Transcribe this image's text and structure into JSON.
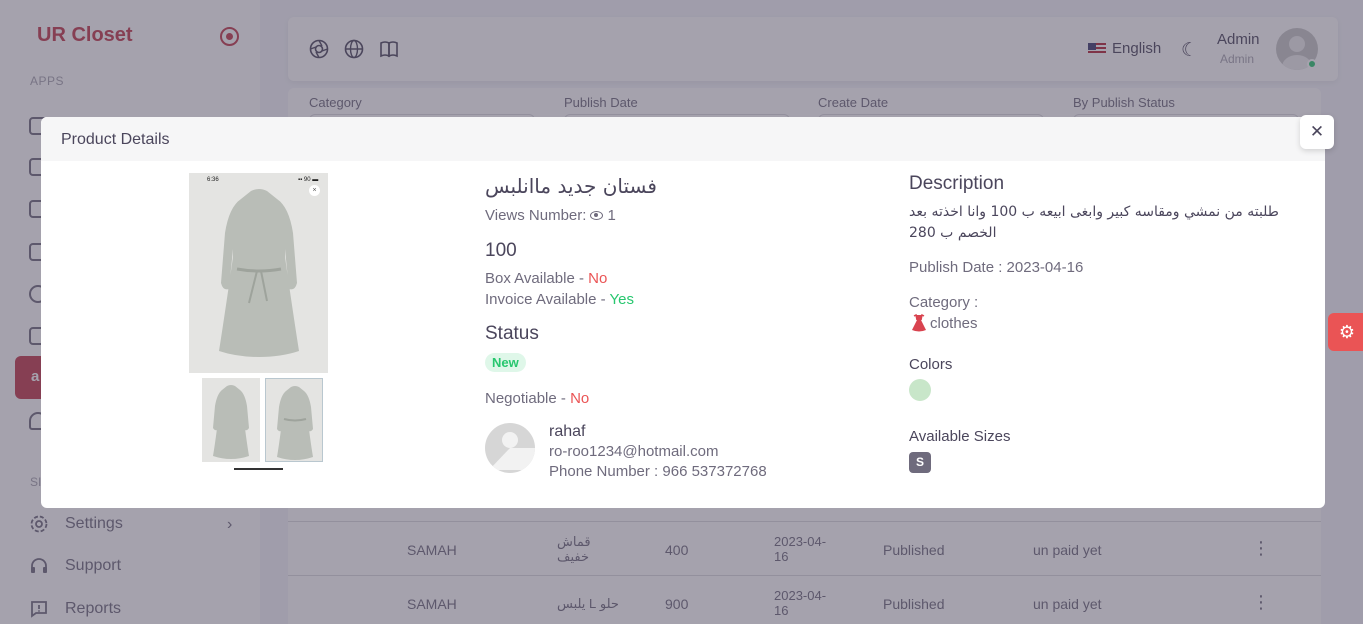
{
  "app": {
    "logo": "UR Closet"
  },
  "sidebar": {
    "apps_label": "APPS",
    "section_label": "SI",
    "active_letter": "a",
    "items": [
      {
        "label": "Settings",
        "icon": "gear-icon"
      },
      {
        "label": "Support",
        "icon": "headset-icon"
      },
      {
        "label": "Reports",
        "icon": "report-icon"
      }
    ]
  },
  "navbar": {
    "language": "English",
    "user_name": "Admin",
    "user_role": "Admin"
  },
  "filters": {
    "labels": [
      "Category",
      "Publish Date",
      "Create Date",
      "By Publish Status"
    ]
  },
  "table": {
    "rows": [
      {
        "seller": "SAMAH",
        "product": "قماش خفيف",
        "price": "400",
        "date": "2023-04-16",
        "status": "Published",
        "payment": "un paid yet"
      },
      {
        "seller": "SAMAH",
        "product": "حلو L يلبس",
        "price": "900",
        "date": "2023-04-16",
        "status": "Published",
        "payment": "un paid yet"
      }
    ]
  },
  "modal": {
    "title": "Product Details",
    "close_glyph": "✕",
    "image": {
      "time": "6:36",
      "status_bar": "▪▪ 90 ▬",
      "close_glyph": "×"
    },
    "product": {
      "title": "فستان جديد ماانلبس",
      "views_label": "Views Number:",
      "views": "1",
      "price": "100",
      "box_label": "Box Available - ",
      "box_value": "No",
      "invoice_label": "Invoice Available - ",
      "invoice_value": "Yes",
      "status_heading": "Status",
      "status_badge": "New",
      "negotiable_label": "Negotiable - ",
      "negotiable_value": "No"
    },
    "seller": {
      "name": "rahaf",
      "email": "ro-roo1234@hotmail.com",
      "phone": "Phone Number : 966 537372768"
    },
    "details": {
      "description_heading": "Description",
      "description": "طلبته من نمشي ومقاسه كبير وابغى ابيعه ب 100 وانا اخذته بعد الخصم ب 280",
      "publish_date": "Publish Date : 2023-04-16",
      "category_label": "Category :",
      "category": "clothes",
      "category_icon": "dress-icon",
      "colors_heading": "Colors",
      "color_swatch": "#c8e6c9",
      "sizes_heading": "Available Sizes",
      "size": "S"
    }
  },
  "theme": {
    "brand": "#c0394b",
    "success": "#28c76f",
    "danger": "#ea5455"
  }
}
